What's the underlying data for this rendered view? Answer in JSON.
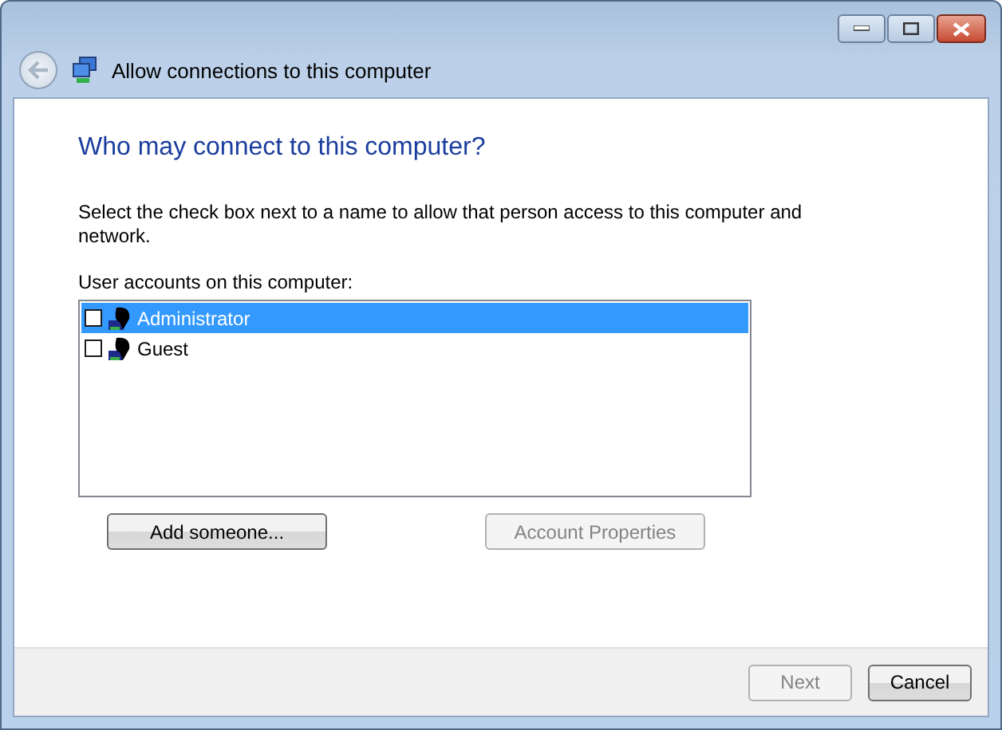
{
  "window": {
    "title": "Allow connections to this computer"
  },
  "heading": "Who may connect to this computer?",
  "instructions": "Select the check box next to a name to allow that person access to this computer and network.",
  "list_label": "User accounts on this computer:",
  "accounts": [
    {
      "name": "Administrator",
      "checked": false,
      "selected": true
    },
    {
      "name": "Guest",
      "checked": false,
      "selected": false
    }
  ],
  "list_buttons": [
    {
      "label": "Add someone...",
      "disabled": false
    },
    {
      "label": "Account Properties",
      "disabled": true
    }
  ],
  "footer_buttons": [
    {
      "label": "Next",
      "disabled": true
    },
    {
      "label": "Cancel",
      "disabled": false
    }
  ]
}
